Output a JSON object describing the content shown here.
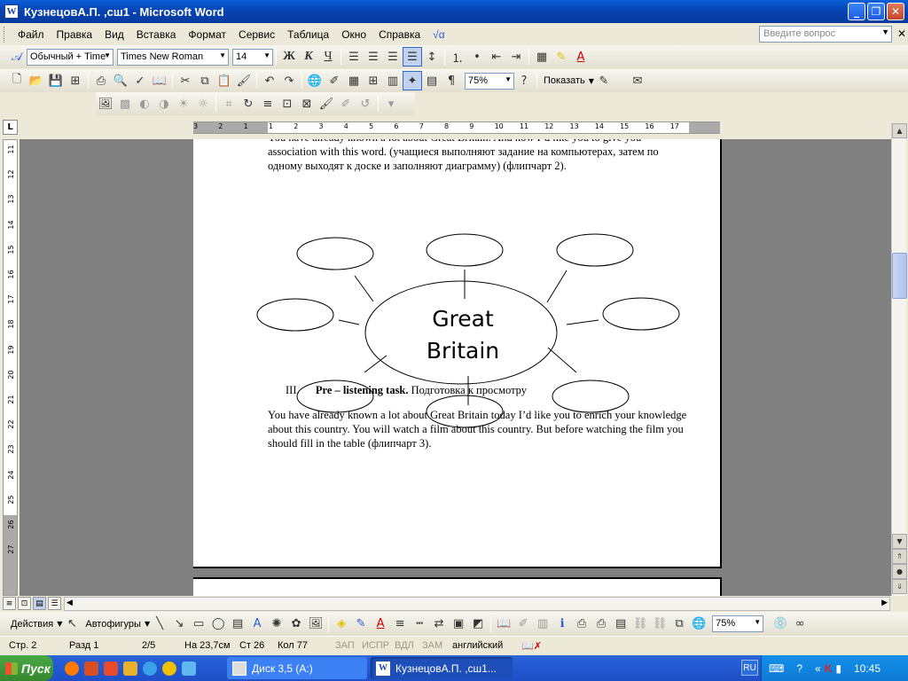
{
  "window": {
    "title": "КузнецовА.П. ,сш1 - Microsoft Word"
  },
  "menu": {
    "items": [
      "Файл",
      "Правка",
      "Вид",
      "Вставка",
      "Формат",
      "Сервис",
      "Таблица",
      "Окно",
      "Справка",
      "√α"
    ],
    "help_placeholder": "Введите вопрос"
  },
  "formatting": {
    "style": "Обычный + Time",
    "font": "Times New Roman",
    "size": "14",
    "bold_label": "Ж",
    "italic_label": "К",
    "underline_label": "Ч"
  },
  "standard": {
    "zoom": "75%",
    "show_label": "Показать"
  },
  "ruler": {
    "h_labels": [
      "3",
      "2",
      "1",
      "1",
      "2",
      "3",
      "4",
      "5",
      "6",
      "7",
      "8",
      "9",
      "10",
      "11",
      "12",
      "13",
      "14",
      "15",
      "16",
      "17"
    ],
    "v_labels": [
      "11",
      "12",
      "13",
      "14",
      "15",
      "16",
      "17",
      "18",
      "19",
      "20",
      "21",
      "22",
      "23",
      "24",
      "25",
      "26",
      "27"
    ]
  },
  "document": {
    "para1": "You have already known a lot about Great Britain. And now I’d like you to give you association with this word. (учащиеся выполняют задание на компьютерах, затем по одному выходят к доске и заполняют диаграмму) (флипчарт 2).",
    "diagram_center_line1": "Great",
    "diagram_center_line2": "Britain",
    "heading_number": "III.",
    "heading_bold": "Pre – listening task.",
    "heading_rest": " Подготовка к просмотру",
    "para2": "You have already known a lot about Great Britain today I’d like you to enrich your knowledge about this country. You will watch a film about this country. But before watching the film you should fill in the table (флипчарт 3)."
  },
  "drawing": {
    "actions_label": "Действия",
    "autoshapes_label": "Автофигуры",
    "zoom": "75%"
  },
  "status": {
    "page": "Стр. 2",
    "section": "Разд 1",
    "pages": "2/5",
    "position": "На 23,7см",
    "line": "Ст 26",
    "column": "Кол 77",
    "rec": "ЗАП",
    "trk": "ИСПР",
    "ext": "ВДЛ",
    "ovr": "ЗАМ",
    "language": "английский"
  },
  "taskbar": {
    "start_label": "Пуск",
    "tasks": [
      "Диск 3,5 (A:)",
      "КузнецовА.П. ,сш1..."
    ],
    "lang": "RU",
    "clock": "10:45"
  },
  "colors": {
    "titlebar": "#0842b0",
    "taskbar": "#245ed6",
    "start": "#35882e",
    "tray": "#0f7ad6"
  }
}
